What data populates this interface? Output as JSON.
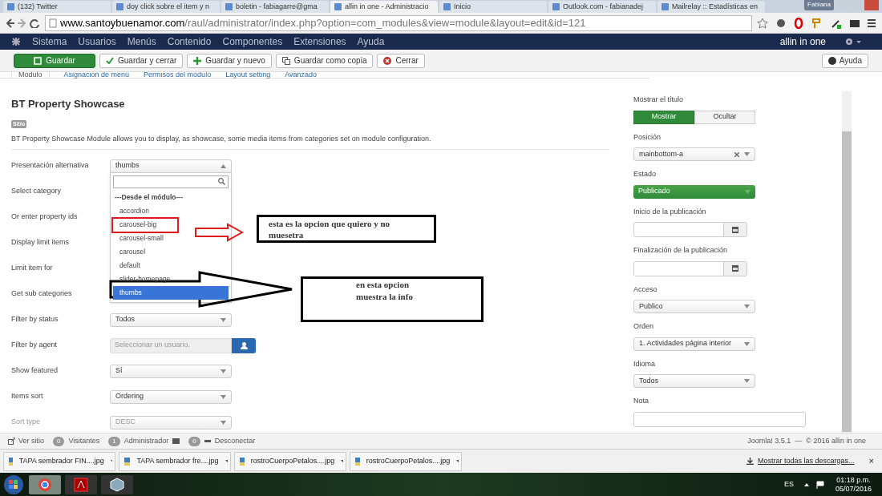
{
  "browser": {
    "tabs": [
      {
        "title": "(132) Twitter",
        "selected": false
      },
      {
        "title": "doy click sobre el item y n",
        "selected": false
      },
      {
        "title": "boletin - fabiagarre@gma",
        "selected": false
      },
      {
        "title": "allin in one - Administracio",
        "selected": true
      },
      {
        "title": "Inicio",
        "selected": false
      },
      {
        "title": "Outlook.com - fabianadej",
        "selected": false
      },
      {
        "title": "Mailrelay :: Estadísticas en",
        "selected": false
      }
    ],
    "user": "Fabiana",
    "url_host": "www.santoybuenamor.com",
    "url_path": "/raul/administrator/index.php?option=com_modules&view=module&layout=edit&id=121"
  },
  "navbar": {
    "menu": [
      "Sistema",
      "Usuarios",
      "Menús",
      "Contenido",
      "Componentes",
      "Extensiones",
      "Ayuda"
    ],
    "site": "allin in one"
  },
  "toolbar": [
    {
      "label": "Guardar",
      "kind": "primary"
    },
    {
      "label": "Guardar y cerrar",
      "kind": "check"
    },
    {
      "label": "Guardar y nuevo",
      "kind": "plus"
    },
    {
      "label": "Guardar como copia",
      "kind": "copy"
    },
    {
      "label": "Cerrar",
      "kind": "close"
    }
  ],
  "help": "Ayuda",
  "tabs": [
    {
      "label": "Módulo",
      "selected": true
    },
    {
      "label": "Asignación de menú",
      "selected": false
    },
    {
      "label": "Permisos del módulo",
      "selected": false
    },
    {
      "label": "Layout setting",
      "selected": false
    },
    {
      "label": "Avanzado",
      "selected": false
    }
  ],
  "module": {
    "title": "BT Property Showcase",
    "badge": "Sitio",
    "description": "BT Property Showcase Module allows you to display, as showcase, some media items from categories set on module configuration."
  },
  "fields": [
    {
      "label": "Presentación alternativa",
      "kind": "open-select",
      "value": "thumbs"
    },
    {
      "label": "Select category",
      "kind": "hidden"
    },
    {
      "label": "Or enter property ids",
      "kind": "hidden"
    },
    {
      "label": "Display limit items",
      "kind": "hidden"
    },
    {
      "label": "Limit item for",
      "kind": "hidden"
    },
    {
      "label": "Get sub categories",
      "kind": "hidden"
    },
    {
      "label": "Filter by status",
      "kind": "select",
      "value": "Todos",
      "disabled": false
    },
    {
      "label": "Filter by agent",
      "kind": "user",
      "placeholder": "Seleccionar un usuario."
    },
    {
      "label": "Show featured",
      "kind": "select",
      "value": "Sí",
      "disabled": false
    },
    {
      "label": "Items sort",
      "kind": "select",
      "value": "Ordering",
      "disabled": false
    },
    {
      "label": "Sort type",
      "kind": "select",
      "value": "DESC",
      "disabled": true
    }
  ],
  "dropdown": {
    "group": "---Desde el módulo---",
    "options": [
      {
        "label": "accordion",
        "selected": false
      },
      {
        "label": "carousel-big",
        "selected": false
      },
      {
        "label": "carousel-small",
        "selected": false
      },
      {
        "label": "carousel",
        "selected": false
      },
      {
        "label": "default",
        "selected": false
      },
      {
        "label": "slider-homepage",
        "selected": false
      },
      {
        "label": "thumbs",
        "selected": true
      }
    ]
  },
  "annotations": [
    {
      "text": "esta es la opcion que quiero y no muesetra"
    },
    {
      "text": "en esta opcion muestra la info"
    }
  ],
  "side": {
    "show_title": {
      "label": "Mostrar el título",
      "options": [
        {
          "label": "Mostrar",
          "selected": true
        },
        {
          "label": "Ocultar",
          "selected": false
        }
      ]
    },
    "position": {
      "label": "Posición",
      "value": "mainbottom-a"
    },
    "state": {
      "label": "Estado",
      "value": "Publicado"
    },
    "dates": [
      {
        "label": "Inicio de la publicación"
      },
      {
        "label": "Finalización de la publicación"
      }
    ],
    "selects": [
      {
        "label": "Acceso",
        "value": "Publico"
      },
      {
        "label": "Orden",
        "value": "1. Actividades página interior"
      },
      {
        "label": "Idioma",
        "value": "Todos"
      }
    ],
    "note": {
      "label": "Nota"
    }
  },
  "status": {
    "view": "Ver sitio",
    "visitors_count": "0",
    "visitors": "Visitantes",
    "admin_count": "1",
    "admin": "Administrador",
    "messages_count": "0",
    "logout": "Desconectar",
    "version": "Joomla! 3.5.1  —  © 2016 allin in one"
  },
  "downloads": {
    "items": [
      "TAPA sembrador FIN....jpg",
      "TAPA sembrador fre....jpg",
      "rostroCuerpoPetalos....jpg",
      "rostroCuerpoPetalos....jpg"
    ],
    "show_all": "Mostrar todas las descargas...",
    "close": "×"
  },
  "taskbar": {
    "lang": "ES",
    "time": "01:18 p.m.",
    "date": "05/07/2016"
  }
}
